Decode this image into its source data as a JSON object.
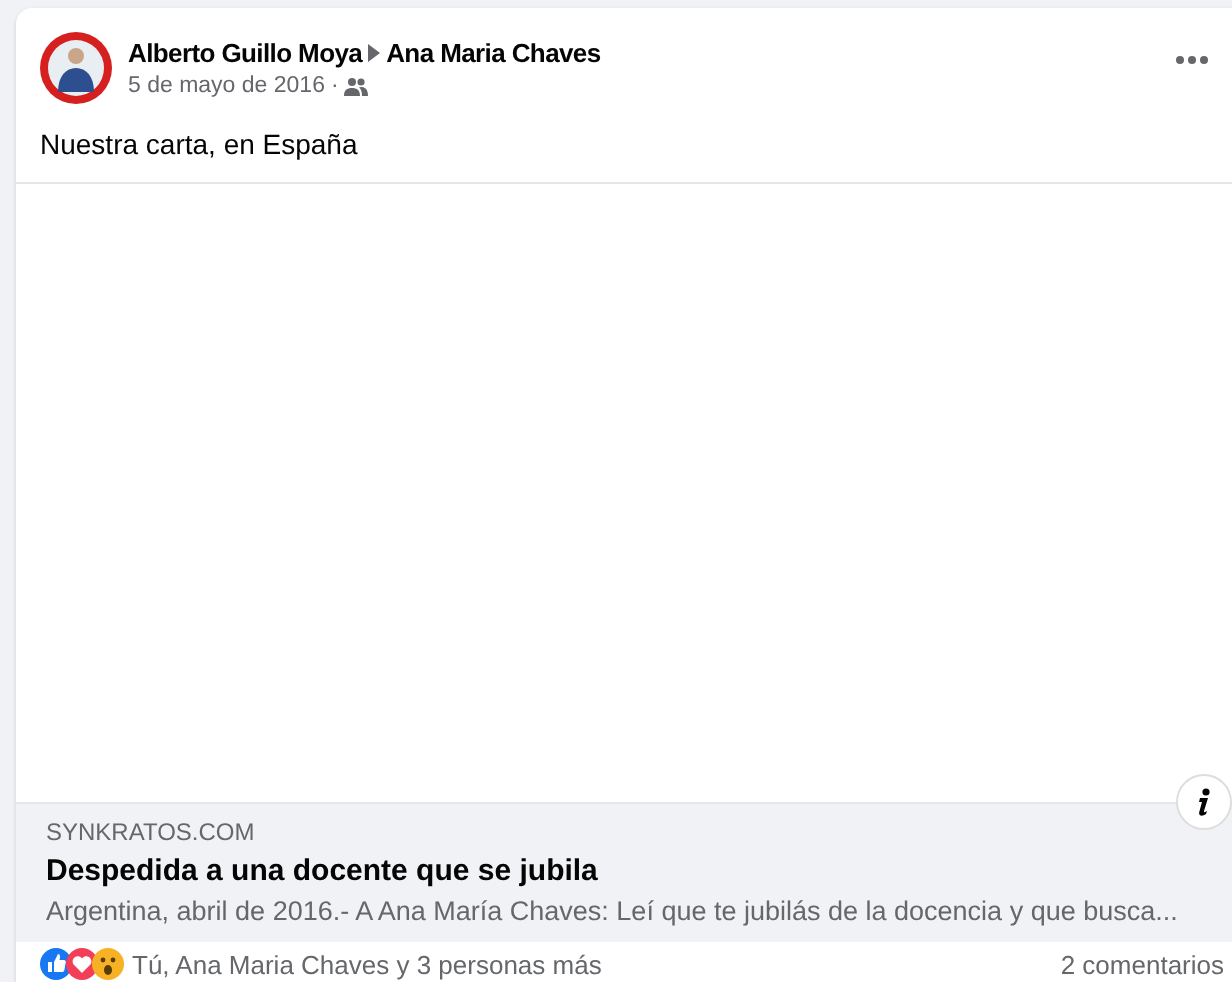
{
  "post": {
    "author": "Alberto Guillo Moya",
    "recipient": "Ana Maria Chaves",
    "date": "5 de mayo de 2016",
    "separator": "·",
    "text": "Nuestra carta, en España"
  },
  "link_preview": {
    "domain": "SYNKRATOS.COM",
    "title": "Despedida a una docente que se jubila",
    "description": "Argentina, abril de 2016.- A Ana María Chaves: Leí que te jubilás de la docencia y que busca..."
  },
  "reactions": {
    "types": [
      {
        "kind": "like"
      },
      {
        "kind": "love"
      },
      {
        "kind": "wow"
      }
    ],
    "summary": "Tú, Ana Maria Chaves y 3 personas más",
    "comments": "2 comentarios"
  }
}
